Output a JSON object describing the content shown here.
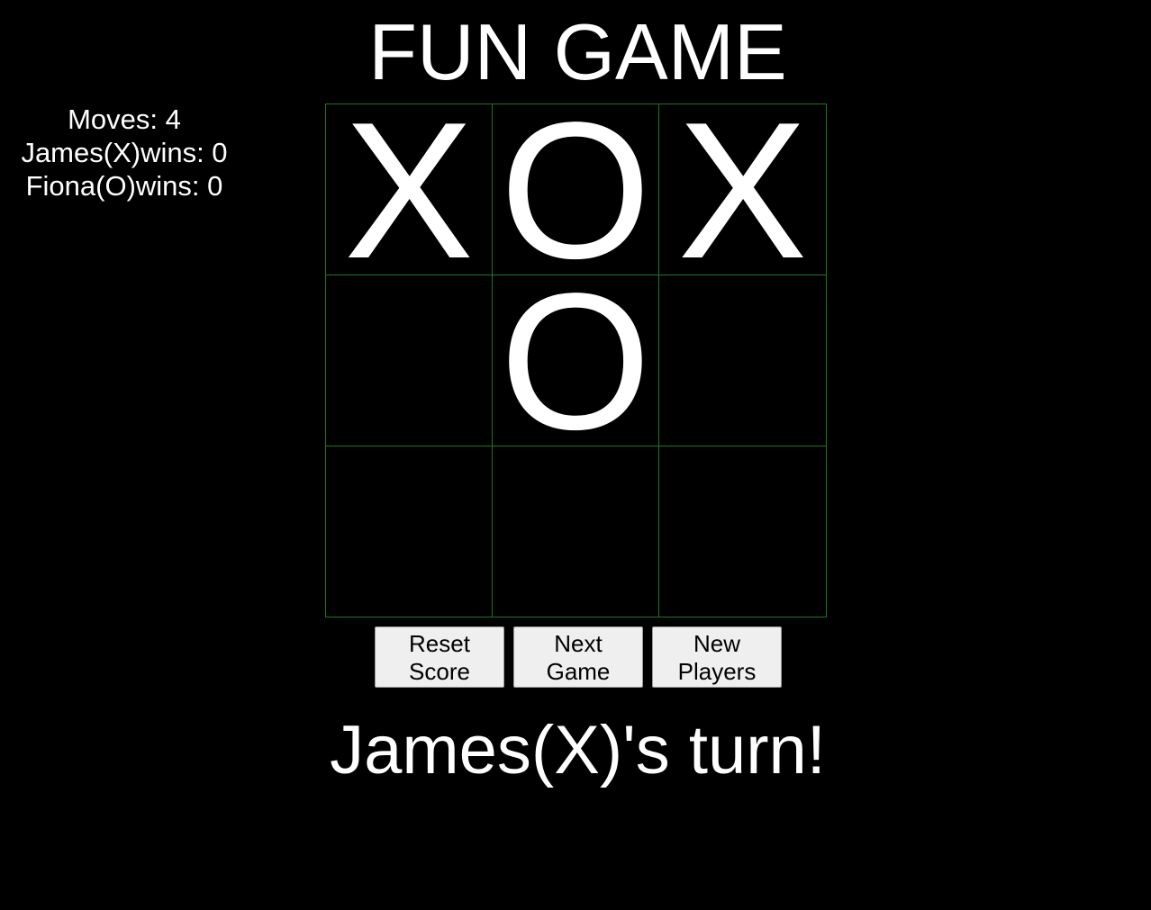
{
  "title": "FUN GAME",
  "scoreboard": {
    "moves": "Moves: 4",
    "player_x_wins": "James(X)wins: 0",
    "player_o_wins": "Fiona(O)wins: 0"
  },
  "board": {
    "cells": [
      "X",
      "O",
      "X",
      "",
      "O",
      "",
      "",
      "",
      ""
    ]
  },
  "buttons": {
    "reset_score": [
      "Reset",
      "Score"
    ],
    "next_game": [
      "Next",
      "Game"
    ],
    "new_players": [
      "New",
      "Players"
    ]
  },
  "status": "James(X)'s turn!",
  "colors": {
    "background": "#000000",
    "grid_line": "#1c7a1c",
    "text": "#ffffff",
    "button_bg": "#efefef"
  }
}
